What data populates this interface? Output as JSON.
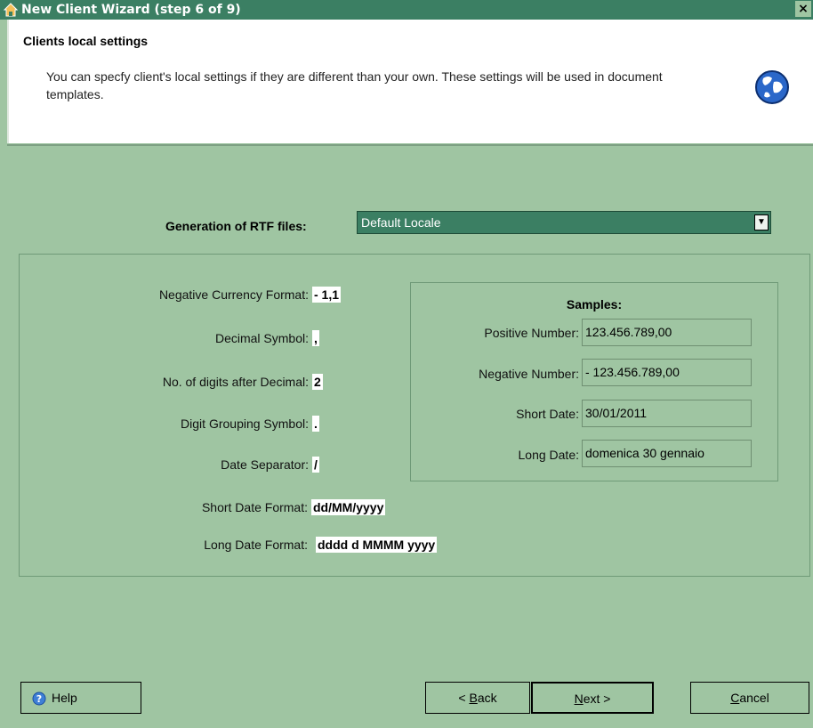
{
  "window": {
    "title": "New Client Wizard  (step 6 of 9)",
    "close_glyph": "×"
  },
  "header": {
    "title": "Clients local settings",
    "description": "You can specfy client's local settings if they are different than your own. These settings will be used in document templates."
  },
  "rtf": {
    "label": "Generation of RTF files:",
    "value": "Default Locale"
  },
  "fields": [
    {
      "label": "Negative Currency Format:",
      "value": "- 1,1"
    },
    {
      "label": "Decimal Symbol:",
      "value": ","
    },
    {
      "label": "No. of digits after Decimal:",
      "value": "2"
    },
    {
      "label": "Digit Grouping Symbol:",
      "value": "."
    },
    {
      "label": "Date Separator:",
      "value": "/"
    },
    {
      "label": "Short Date Format:",
      "value": "dd/MM/yyyy"
    },
    {
      "label": "Long Date Format:",
      "value": "dddd d MMMM yyyy"
    }
  ],
  "samples": {
    "title": "Samples:",
    "rows": [
      {
        "label": "Positive Number:",
        "value": "123.456.789,00"
      },
      {
        "label": "Negative Number:",
        "value": "- 123.456.789,00"
      },
      {
        "label": "Short Date:",
        "value": "30/01/2011"
      },
      {
        "label": "Long Date:",
        "value": "domenica 30 gennaio"
      }
    ]
  },
  "buttons": {
    "help": "Help",
    "back_prefix": "< ",
    "back_key": "B",
    "back_rest": "ack",
    "next_key": "N",
    "next_rest": "ext >",
    "cancel_key": "C",
    "cancel_rest": "ancel"
  },
  "colors": {
    "titlebar": "#3b7f63",
    "panel": "#9fc5a2",
    "header": "#ffffff"
  },
  "icons": {
    "app": "home-icon",
    "globe": "globe-icon",
    "help": "help-icon",
    "dropdown": "chevron-down-icon"
  }
}
